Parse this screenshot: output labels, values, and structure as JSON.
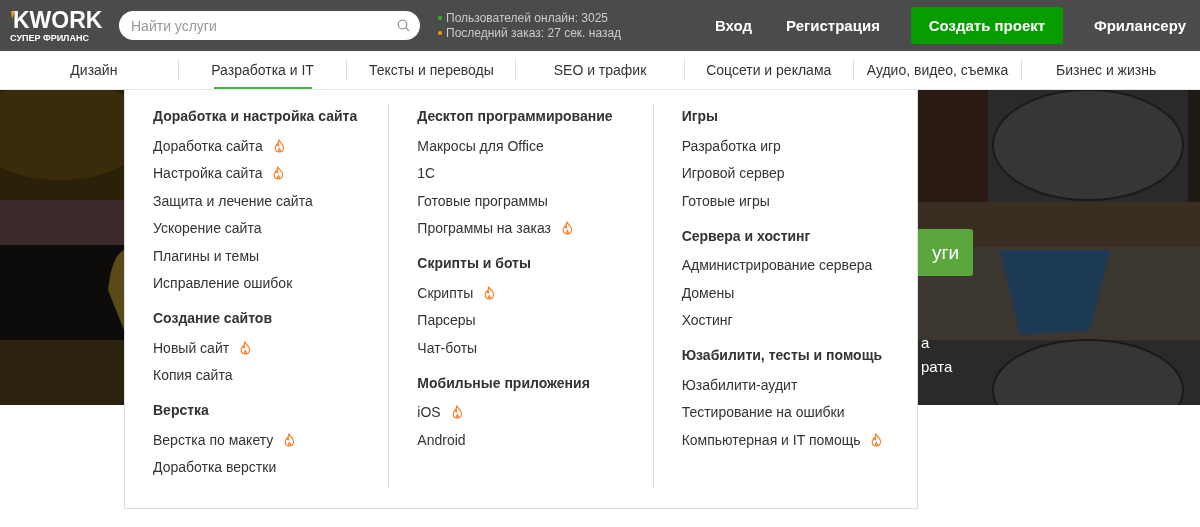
{
  "header": {
    "logo": {
      "wordmark": "KWORK",
      "tagline": "СУПЕР ФРИЛАНС"
    },
    "search": {
      "placeholder": "Найти услуги"
    },
    "stats": [
      {
        "text": "Пользователей онлайн: 3025",
        "color": "#2db82d"
      },
      {
        "text": "Последний заказ: 27 сек. назад",
        "color": "#f39c12"
      }
    ],
    "links": [
      "Вход",
      "Регистрация"
    ],
    "create_button": "Создать проект",
    "freelancer_link": "Фрилансеру"
  },
  "categories": [
    {
      "label": "Дизайн",
      "selected": false
    },
    {
      "label": "Разработка и IT",
      "selected": true
    },
    {
      "label": "Тексты и переводы",
      "selected": false
    },
    {
      "label": "SEO и трафик",
      "selected": false
    },
    {
      "label": "Соцсети и реклама",
      "selected": false
    },
    {
      "label": "Аудио, видео, съемка",
      "selected": false
    },
    {
      "label": "Бизнес и жизнь",
      "selected": false
    }
  ],
  "hero": {
    "button": "уги",
    "lines": [
      "а",
      "рата"
    ]
  },
  "dropdown": {
    "columns": [
      [
        {
          "title": "Доработка и настройка сайта",
          "items": [
            {
              "label": "Доработка сайта",
              "hot": true
            },
            {
              "label": "Настройка сайта",
              "hot": true
            },
            {
              "label": "Защита и лечение сайта",
              "hot": false
            },
            {
              "label": "Ускорение сайта",
              "hot": false
            },
            {
              "label": "Плагины и темы",
              "hot": false
            },
            {
              "label": "Исправление ошибок",
              "hot": false
            }
          ]
        },
        {
          "title": "Создание сайтов",
          "items": [
            {
              "label": "Новый сайт",
              "hot": true
            },
            {
              "label": "Копия сайта",
              "hot": false
            }
          ]
        },
        {
          "title": "Верстка",
          "items": [
            {
              "label": "Верстка по макету",
              "hot": true
            },
            {
              "label": "Доработка верстки",
              "hot": false
            }
          ]
        }
      ],
      [
        {
          "title": "Десктоп программирование",
          "items": [
            {
              "label": "Макросы для Office",
              "hot": false
            },
            {
              "label": "1С",
              "hot": false
            },
            {
              "label": "Готовые программы",
              "hot": false
            },
            {
              "label": "Программы на заказ",
              "hot": true
            }
          ]
        },
        {
          "title": "Скрипты и боты",
          "items": [
            {
              "label": "Скрипты",
              "hot": true
            },
            {
              "label": "Парсеры",
              "hot": false
            },
            {
              "label": "Чат-боты",
              "hot": false
            }
          ]
        },
        {
          "title": "Мобильные приложения",
          "items": [
            {
              "label": "iOS",
              "hot": true
            },
            {
              "label": "Android",
              "hot": false
            }
          ]
        }
      ],
      [
        {
          "title": "Игры",
          "items": [
            {
              "label": "Разработка игр",
              "hot": false
            },
            {
              "label": "Игровой сервер",
              "hot": false
            },
            {
              "label": "Готовые игры",
              "hot": false
            }
          ]
        },
        {
          "title": "Сервера и хостинг",
          "items": [
            {
              "label": "Администрирование сервера",
              "hot": false
            },
            {
              "label": "Домены",
              "hot": false
            },
            {
              "label": "Хостинг",
              "hot": false
            }
          ]
        },
        {
          "title": "Юзабилити, тесты и помощь",
          "items": [
            {
              "label": "Юзабилити-аудит",
              "hot": false
            },
            {
              "label": "Тестирование на ошибки",
              "hot": false
            },
            {
              "label": "Компьютерная и IT помощь",
              "hot": true
            }
          ]
        }
      ]
    ]
  }
}
